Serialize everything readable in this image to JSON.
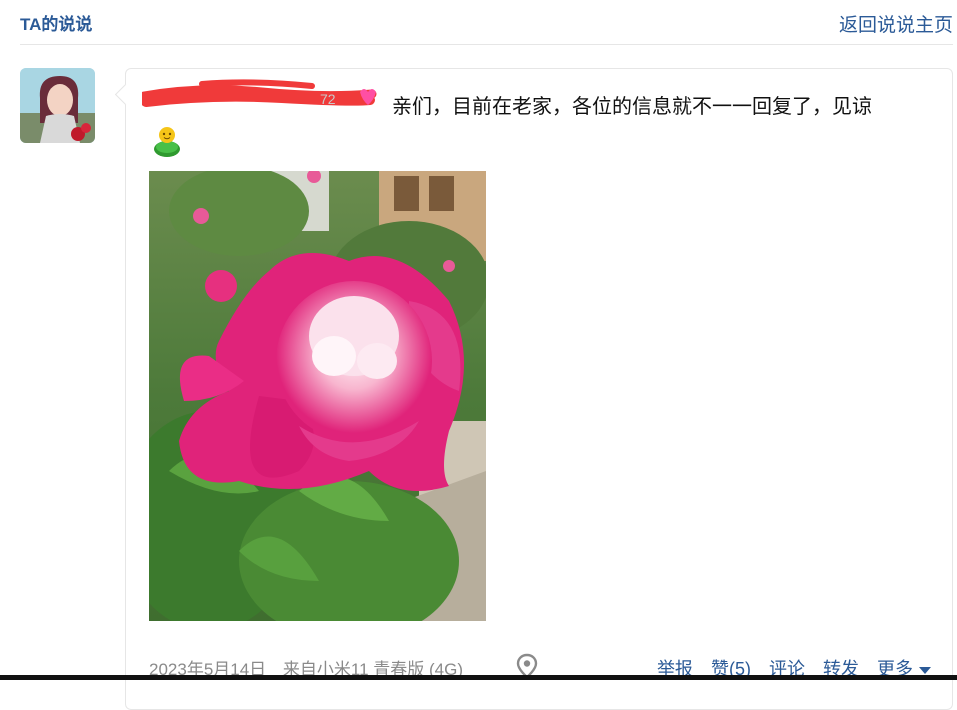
{
  "header": {
    "title": "TA的说说",
    "back_link": "返回说说主页"
  },
  "post": {
    "author_suffix": "72",
    "text": "亲们，目前在老家，各位的信息就不一一回复了，见谅",
    "photo_icon": "peony-flower-photo",
    "emoji_icon": "lemon-emoji-icon"
  },
  "footer": {
    "date": "2023年5月14日",
    "device": "来自小米11 青春版 (4G)",
    "location_icon": "location-pin-icon",
    "report": "举报",
    "like": "赞(5)",
    "comment": "评论",
    "forward": "转发",
    "more": "更多"
  },
  "colors": {
    "link": "#2b5a97",
    "muted": "#8a8a8a",
    "redaction": "#f03a3a"
  }
}
